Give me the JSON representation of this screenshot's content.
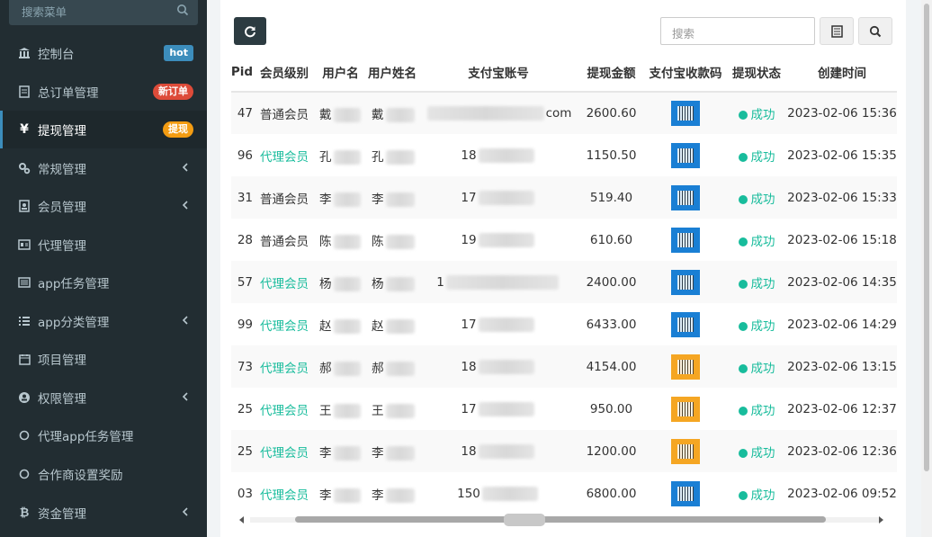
{
  "sidebar": {
    "search_placeholder": "搜索菜单",
    "items": [
      {
        "label": "控制台",
        "badge": "hot"
      },
      {
        "label": "总订单管理",
        "badge": "新订单"
      },
      {
        "label": "提现管理",
        "badge": "提现"
      },
      {
        "label": "常规管理"
      },
      {
        "label": "会员管理"
      },
      {
        "label": "代理管理"
      },
      {
        "label": "app任务管理"
      },
      {
        "label": "app分类管理"
      },
      {
        "label": "项目管理"
      },
      {
        "label": "权限管理"
      },
      {
        "label": "代理app任务管理"
      },
      {
        "label": "合作商设置奖励"
      },
      {
        "label": "资金管理"
      }
    ]
  },
  "toolbar": {
    "search_placeholder": "搜索"
  },
  "table": {
    "headers": [
      "Pid",
      "会员级别",
      "用户名",
      "用户姓名",
      "支付宝账号",
      "提现金额",
      "支付宝收款码",
      "提现状态",
      "创建时间"
    ],
    "rows": [
      {
        "pid": "47",
        "level": "普通会员",
        "user_initial": "戴",
        "name_initial": "戴",
        "account": "com",
        "amount": "2600.60",
        "qr": "blue",
        "status": "成功",
        "time": "2023-02-06 15:36"
      },
      {
        "pid": "96",
        "level": "代理会员",
        "user_initial": "孔",
        "name_initial": "孔",
        "account": "18",
        "amount": "1150.50",
        "qr": "blue",
        "status": "成功",
        "time": "2023-02-06 15:35"
      },
      {
        "pid": "31",
        "level": "普通会员",
        "user_initial": "李",
        "name_initial": "李",
        "account": "17",
        "amount": "519.40",
        "qr": "blue",
        "status": "成功",
        "time": "2023-02-06 15:33"
      },
      {
        "pid": "28",
        "level": "普通会员",
        "user_initial": "陈",
        "name_initial": "陈",
        "account": "19",
        "amount": "610.60",
        "qr": "blue",
        "status": "成功",
        "time": "2023-02-06 15:18"
      },
      {
        "pid": "57",
        "level": "代理会员",
        "user_initial": "杨",
        "name_initial": "杨",
        "account": "1",
        "amount": "2400.00",
        "qr": "blue",
        "status": "成功",
        "time": "2023-02-06 14:35"
      },
      {
        "pid": "99",
        "level": "代理会员",
        "user_initial": "赵",
        "name_initial": "赵",
        "account": "17",
        "amount": "6433.00",
        "qr": "blue",
        "status": "成功",
        "time": "2023-02-06 14:29"
      },
      {
        "pid": "73",
        "level": "代理会员",
        "user_initial": "郝",
        "name_initial": "郝",
        "account": "18",
        "amount": "4154.00",
        "qr": "orange",
        "status": "成功",
        "time": "2023-02-06 13:15"
      },
      {
        "pid": "25",
        "level": "代理会员",
        "user_initial": "王",
        "name_initial": "王",
        "account": "17",
        "amount": "950.00",
        "qr": "orange",
        "status": "成功",
        "time": "2023-02-06 12:37"
      },
      {
        "pid": "25",
        "level": "代理会员",
        "user_initial": "李",
        "name_initial": "李",
        "account": "18",
        "amount": "1200.00",
        "qr": "orange",
        "status": "成功",
        "time": "2023-02-06 12:36"
      },
      {
        "pid": "03",
        "level": "代理会员",
        "user_initial": "李",
        "name_initial": "李",
        "account": "150",
        "amount": "6800.00",
        "qr": "blue",
        "status": "成功",
        "time": "2023-02-06 09:52"
      }
    ]
  },
  "colors": {
    "sidebar_bg": "#222d32",
    "accent_green": "#18bc9c",
    "badge_blue": "#3c8dbc",
    "badge_red": "#dd4b39",
    "badge_yellow": "#f39c12"
  }
}
